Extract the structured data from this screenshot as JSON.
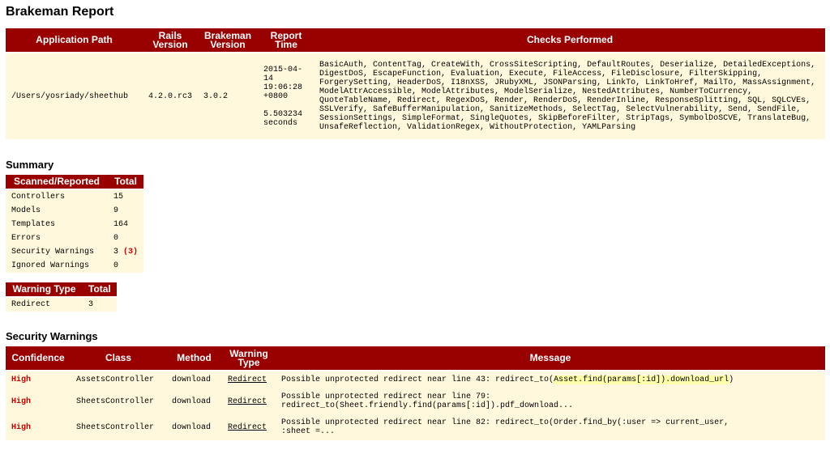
{
  "title": "Brakeman Report",
  "overview": {
    "headers": [
      "Application Path",
      "Rails Version",
      "Brakeman Version",
      "Report Time",
      "Checks Performed"
    ],
    "app_path": "/Users/yosriady/sheethub",
    "rails_version": "4.2.0.rc3",
    "brakeman_version": "3.0.2",
    "report_time_date": "2015-04-14 19:06:28 +0800",
    "report_duration": "5.503234 seconds",
    "checks": "BasicAuth, ContentTag, CreateWith, CrossSiteScripting, DefaultRoutes, Deserialize, DetailedExceptions, DigestDoS, EscapeFunction, Evaluation, Execute, FileAccess, FileDisclosure, FilterSkipping, ForgerySetting, HeaderDoS, I18nXSS, JRubyXML, JSONParsing, LinkTo, LinkToHref, MailTo, MassAssignment, ModelAttrAccessible, ModelAttributes, ModelSerialize, NestedAttributes, NumberToCurrency, QuoteTableName, Redirect, RegexDoS, Render, RenderDoS, RenderInline, ResponseSplitting, SQL, SQLCVEs, SSLVerify, SafeBufferManipulation, SanitizeMethods, SelectTag, SelectVulnerability, Send, SendFile, SessionSettings, SimpleFormat, SingleQuotes, SkipBeforeFilter, StripTags, SymbolDoSCVE, TranslateBug, UnsafeReflection, ValidationRegex, WithoutProtection, YAMLParsing"
  },
  "summary": {
    "heading": "Summary",
    "headers": [
      "Scanned/Reported",
      "Total"
    ],
    "rows": [
      {
        "label": "Controllers",
        "value": "15",
        "extra": ""
      },
      {
        "label": "Models",
        "value": "9",
        "extra": ""
      },
      {
        "label": "Templates",
        "value": "164",
        "extra": ""
      },
      {
        "label": "Errors",
        "value": "0",
        "extra": ""
      },
      {
        "label": "Security Warnings",
        "value": "3",
        "extra": "(3)"
      },
      {
        "label": "Ignored Warnings",
        "value": "0",
        "extra": ""
      }
    ]
  },
  "warning_types": {
    "headers": [
      "Warning Type",
      "Total"
    ],
    "rows": [
      {
        "type": "Redirect",
        "total": "3"
      }
    ]
  },
  "security_warnings": {
    "heading": "Security Warnings",
    "headers": [
      "Confidence",
      "Class",
      "Method",
      "Warning Type",
      "Message"
    ],
    "rows": [
      {
        "confidence": "High",
        "class": "AssetsController",
        "method": "download",
        "type": "Redirect",
        "message_prefix": "Possible unprotected redirect near line 43: redirect_to(",
        "message_highlight": "Asset.find(params[:id]).download_url",
        "message_suffix": ")"
      },
      {
        "confidence": "High",
        "class": "SheetsController",
        "method": "download",
        "type": "Redirect",
        "message_prefix": "Possible unprotected redirect near line 79: redirect_to(Sheet.friendly.find(params[:id]).pdf_download...",
        "message_highlight": "",
        "message_suffix": ""
      },
      {
        "confidence": "High",
        "class": "SheetsController",
        "method": "download",
        "type": "Redirect",
        "message_prefix": "Possible unprotected redirect near line 82: redirect_to(Order.find_by(:user => current_user, :sheet =...",
        "message_highlight": "",
        "message_suffix": ""
      }
    ]
  },
  "colors": {
    "header_bg": "#990000",
    "row_bg": "#fff8dc",
    "high_confidence": "#cc0000",
    "highlight": "#ffffaa"
  }
}
